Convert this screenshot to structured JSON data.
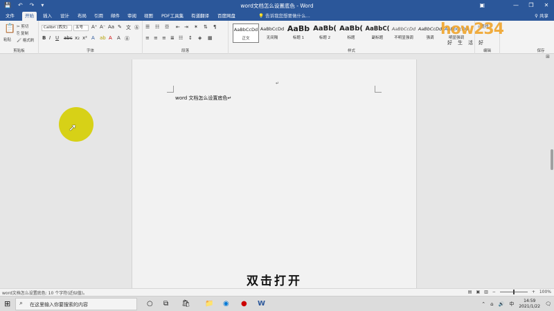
{
  "window": {
    "title": "word文档怎么设置底色 - Word",
    "controls": [
      "—",
      "❐",
      "✕"
    ]
  },
  "qat": [
    "💾",
    "↶",
    "↷",
    "▾"
  ],
  "tabs": [
    "文件",
    "开始",
    "插入",
    "设计",
    "布局",
    "引用",
    "邮件",
    "审阅",
    "视图",
    "PDF工具集",
    "有道翻译",
    "百度网盘"
  ],
  "active_tab": "开始",
  "tell_me": "告诉我您想要做什么...",
  "share": "共享",
  "ribbon": {
    "clipboard": {
      "paste": "粘贴",
      "cut": "剪切",
      "copy": "复制",
      "format_painter": "格式刷",
      "label": "剪贴板"
    },
    "font": {
      "name": "Calibri (西文)",
      "size": "五号",
      "label": "字体"
    },
    "paragraph": {
      "label": "段落"
    },
    "styles": {
      "label": "样式",
      "items": [
        {
          "sample": "AaBbCcDd",
          "name": "正文"
        },
        {
          "sample": "AaBbCcDd",
          "name": "无间隔"
        },
        {
          "sample": "AaBb",
          "name": "标题 1"
        },
        {
          "sample": "AaBb(",
          "name": "标题 2"
        },
        {
          "sample": "AaBb(",
          "name": "标题"
        },
        {
          "sample": "AaBbC(",
          "name": "副标题"
        },
        {
          "sample": "AaBbCcDd",
          "name": "不明显强调"
        },
        {
          "sample": "AaBbCcDd",
          "name": "强调"
        },
        {
          "sample": "AaBbCcDd",
          "name": "明显强调"
        }
      ]
    },
    "editing": {
      "find": "查找",
      "label": "编辑"
    },
    "save": {
      "label": "保存"
    }
  },
  "document": {
    "text": "word 文档怎么设置底色"
  },
  "subtitle": "双击打开",
  "status": {
    "left": "word文档怎么设置底色: 10 个字符(近似值)。",
    "zoom": "100%"
  },
  "taskbar": {
    "search_placeholder": "在这里输入你要搜索的内容",
    "time": "14:59",
    "date": "2021/1/22",
    "ime": "中"
  },
  "watermark": {
    "text": "how234",
    "sub": "好生活好"
  },
  "colors": {
    "brand": "#2b579a",
    "highlight": "#d7d117"
  }
}
